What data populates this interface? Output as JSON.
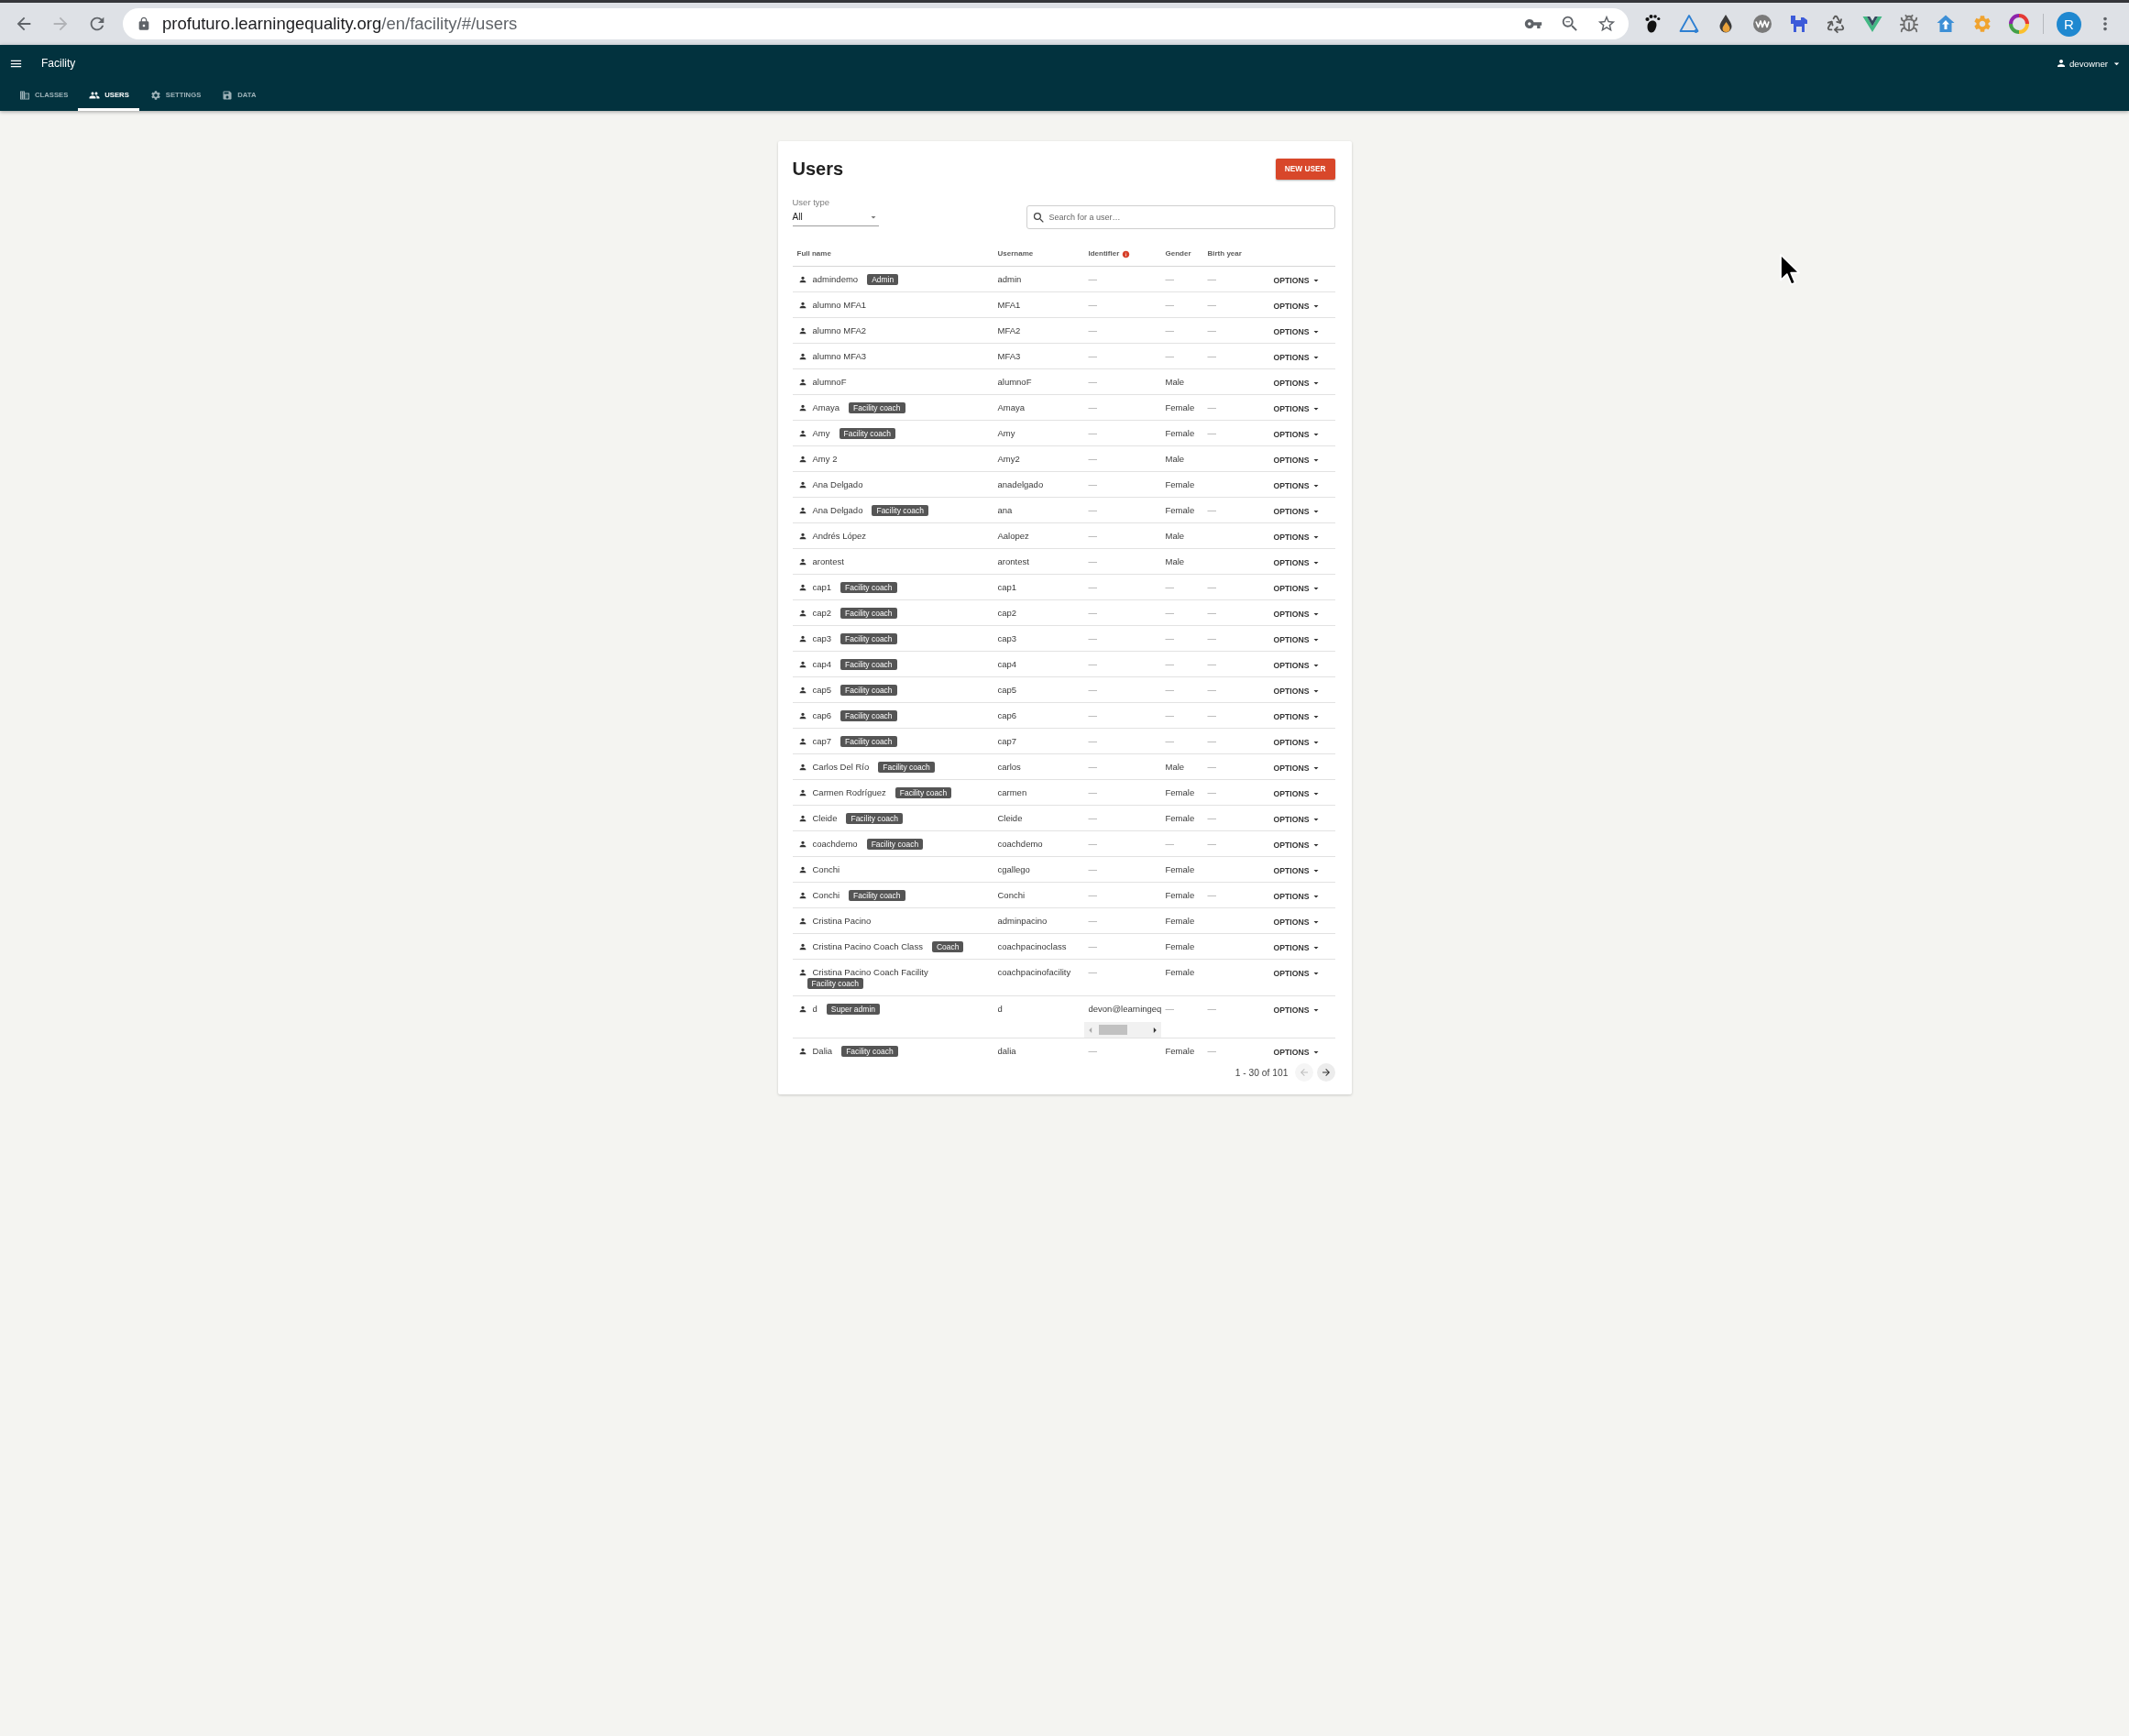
{
  "browser": {
    "back": {
      "disabled": false
    },
    "forward": {
      "disabled": true
    },
    "address": {
      "host": "profuturo.learningequality.org",
      "path": "/en/facility/#/users"
    },
    "profile_initial": "R"
  },
  "app_bar": {
    "title": "Facility",
    "user": "devowner",
    "tabs": [
      {
        "label": "CLASSES",
        "selected": false
      },
      {
        "label": "USERS",
        "selected": true
      },
      {
        "label": "SETTINGS",
        "selected": false
      },
      {
        "label": "DATA",
        "selected": false
      }
    ]
  },
  "users_panel": {
    "title": "Users",
    "new_user_button": "NEW USER",
    "user_type": {
      "label": "User type",
      "value": "All"
    },
    "search": {
      "placeholder": "Search for a user…"
    },
    "table": {
      "columns": [
        {
          "label": "Full name"
        },
        {
          "label": "Username"
        },
        {
          "label": "Identifier",
          "info": true
        },
        {
          "label": "Gender"
        },
        {
          "label": "Birth year"
        }
      ],
      "rows": [
        {
          "full_name": "admindemo",
          "role": "Admin",
          "username": "admin",
          "identifier": "—",
          "gender": "—",
          "birth_year": "—",
          "options": "OPTIONS"
        },
        {
          "full_name": "alumno MFA1",
          "username": "MFA1",
          "identifier": "—",
          "gender": "—",
          "birth_year": "—",
          "options": "OPTIONS"
        },
        {
          "full_name": "alumno MFA2",
          "username": "MFA2",
          "identifier": "—",
          "gender": "—",
          "birth_year": "—",
          "options": "OPTIONS"
        },
        {
          "full_name": "alumno MFA3",
          "username": "MFA3",
          "identifier": "—",
          "gender": "—",
          "birth_year": "—",
          "options": "OPTIONS"
        },
        {
          "full_name": "alumnoF",
          "username": "alumnoF",
          "identifier": "—",
          "gender": "Male",
          "options": "OPTIONS"
        },
        {
          "full_name": "Amaya",
          "role": "Facility coach",
          "username": "Amaya",
          "identifier": "—",
          "gender": "Female",
          "birth_year": "—",
          "options": "OPTIONS"
        },
        {
          "full_name": "Amy",
          "role": "Facility coach",
          "username": "Amy",
          "identifier": "—",
          "gender": "Female",
          "birth_year": "—",
          "options": "OPTIONS"
        },
        {
          "full_name": "Amy 2",
          "username": "Amy2",
          "identifier": "—",
          "gender": "Male",
          "options": "OPTIONS"
        },
        {
          "full_name": "Ana Delgado",
          "username": "anadelgado",
          "identifier": "—",
          "gender": "Female",
          "options": "OPTIONS"
        },
        {
          "full_name": "Ana Delgado",
          "role": "Facility coach",
          "username": "ana",
          "identifier": "—",
          "gender": "Female",
          "birth_year": "—",
          "options": "OPTIONS"
        },
        {
          "full_name": "Andrés López",
          "username": "Aalopez",
          "identifier": "—",
          "gender": "Male",
          "options": "OPTIONS"
        },
        {
          "full_name": "arontest",
          "username": "arontest",
          "identifier": "—",
          "gender": "Male",
          "options": "OPTIONS"
        },
        {
          "full_name": "cap1",
          "role": "Facility coach",
          "username": "cap1",
          "identifier": "—",
          "gender": "—",
          "birth_year": "—",
          "options": "OPTIONS"
        },
        {
          "full_name": "cap2",
          "role": "Facility coach",
          "username": "cap2",
          "identifier": "—",
          "gender": "—",
          "birth_year": "—",
          "options": "OPTIONS"
        },
        {
          "full_name": "cap3",
          "role": "Facility coach",
          "username": "cap3",
          "identifier": "—",
          "gender": "—",
          "birth_year": "—",
          "options": "OPTIONS"
        },
        {
          "full_name": "cap4",
          "role": "Facility coach",
          "username": "cap4",
          "identifier": "—",
          "gender": "—",
          "birth_year": "—",
          "options": "OPTIONS"
        },
        {
          "full_name": "cap5",
          "role": "Facility coach",
          "username": "cap5",
          "identifier": "—",
          "gender": "—",
          "birth_year": "—",
          "options": "OPTIONS"
        },
        {
          "full_name": "cap6",
          "role": "Facility coach",
          "username": "cap6",
          "identifier": "—",
          "gender": "—",
          "birth_year": "—",
          "options": "OPTIONS"
        },
        {
          "full_name": "cap7",
          "role": "Facility coach",
          "username": "cap7",
          "identifier": "—",
          "gender": "—",
          "birth_year": "—",
          "options": "OPTIONS"
        },
        {
          "full_name": "Carlos Del Río",
          "role": "Facility coach",
          "username": "carlos",
          "identifier": "—",
          "gender": "Male",
          "birth_year": "—",
          "options": "OPTIONS"
        },
        {
          "full_name": "Carmen Rodríguez",
          "role": "Facility coach",
          "username": "carmen",
          "identifier": "—",
          "gender": "Female",
          "birth_year": "—",
          "options": "OPTIONS"
        },
        {
          "full_name": "Cleide",
          "role": "Facility coach",
          "username": "Cleide",
          "identifier": "—",
          "gender": "Female",
          "birth_year": "—",
          "options": "OPTIONS"
        },
        {
          "full_name": "coachdemo",
          "role": "Facility coach",
          "username": "coachdemo",
          "identifier": "—",
          "gender": "—",
          "birth_year": "—",
          "options": "OPTIONS"
        },
        {
          "full_name": "Conchi",
          "username": "cgallego",
          "identifier": "—",
          "gender": "Female",
          "options": "OPTIONS"
        },
        {
          "full_name": "Conchi",
          "role": "Facility coach",
          "username": "Conchi",
          "identifier": "—",
          "gender": "Female",
          "birth_year": "—",
          "options": "OPTIONS"
        },
        {
          "full_name": "Cristina Pacino",
          "username": "adminpacino",
          "identifier": "—",
          "gender": "Female",
          "options": "OPTIONS"
        },
        {
          "full_name": "Cristina Pacino Coach Class",
          "role": "Coach",
          "username": "coachpacinoclass",
          "identifier": "—",
          "gender": "Female",
          "options": "OPTIONS"
        },
        {
          "full_name": "Cristina Pacino Coach Facility",
          "role": "Facility coach",
          "username": "coachpacinofacility",
          "identifier": "—",
          "gender": "Female",
          "options": "OPTIONS"
        },
        {
          "full_name": "d",
          "role": "Super admin",
          "username": "d",
          "identifier": "devon@learningeq",
          "identifier_scroll": true,
          "gender": "—",
          "birth_year": "—",
          "options": "OPTIONS"
        },
        {
          "full_name": "Dalia",
          "role": "Facility coach",
          "username": "dalia",
          "identifier": "—",
          "gender": "Female",
          "birth_year": "—",
          "options": "OPTIONS"
        }
      ]
    },
    "pagination": {
      "range": "1 - 30 of 101",
      "previous": {
        "disabled": true
      },
      "next": {
        "disabled": false
      }
    }
  }
}
